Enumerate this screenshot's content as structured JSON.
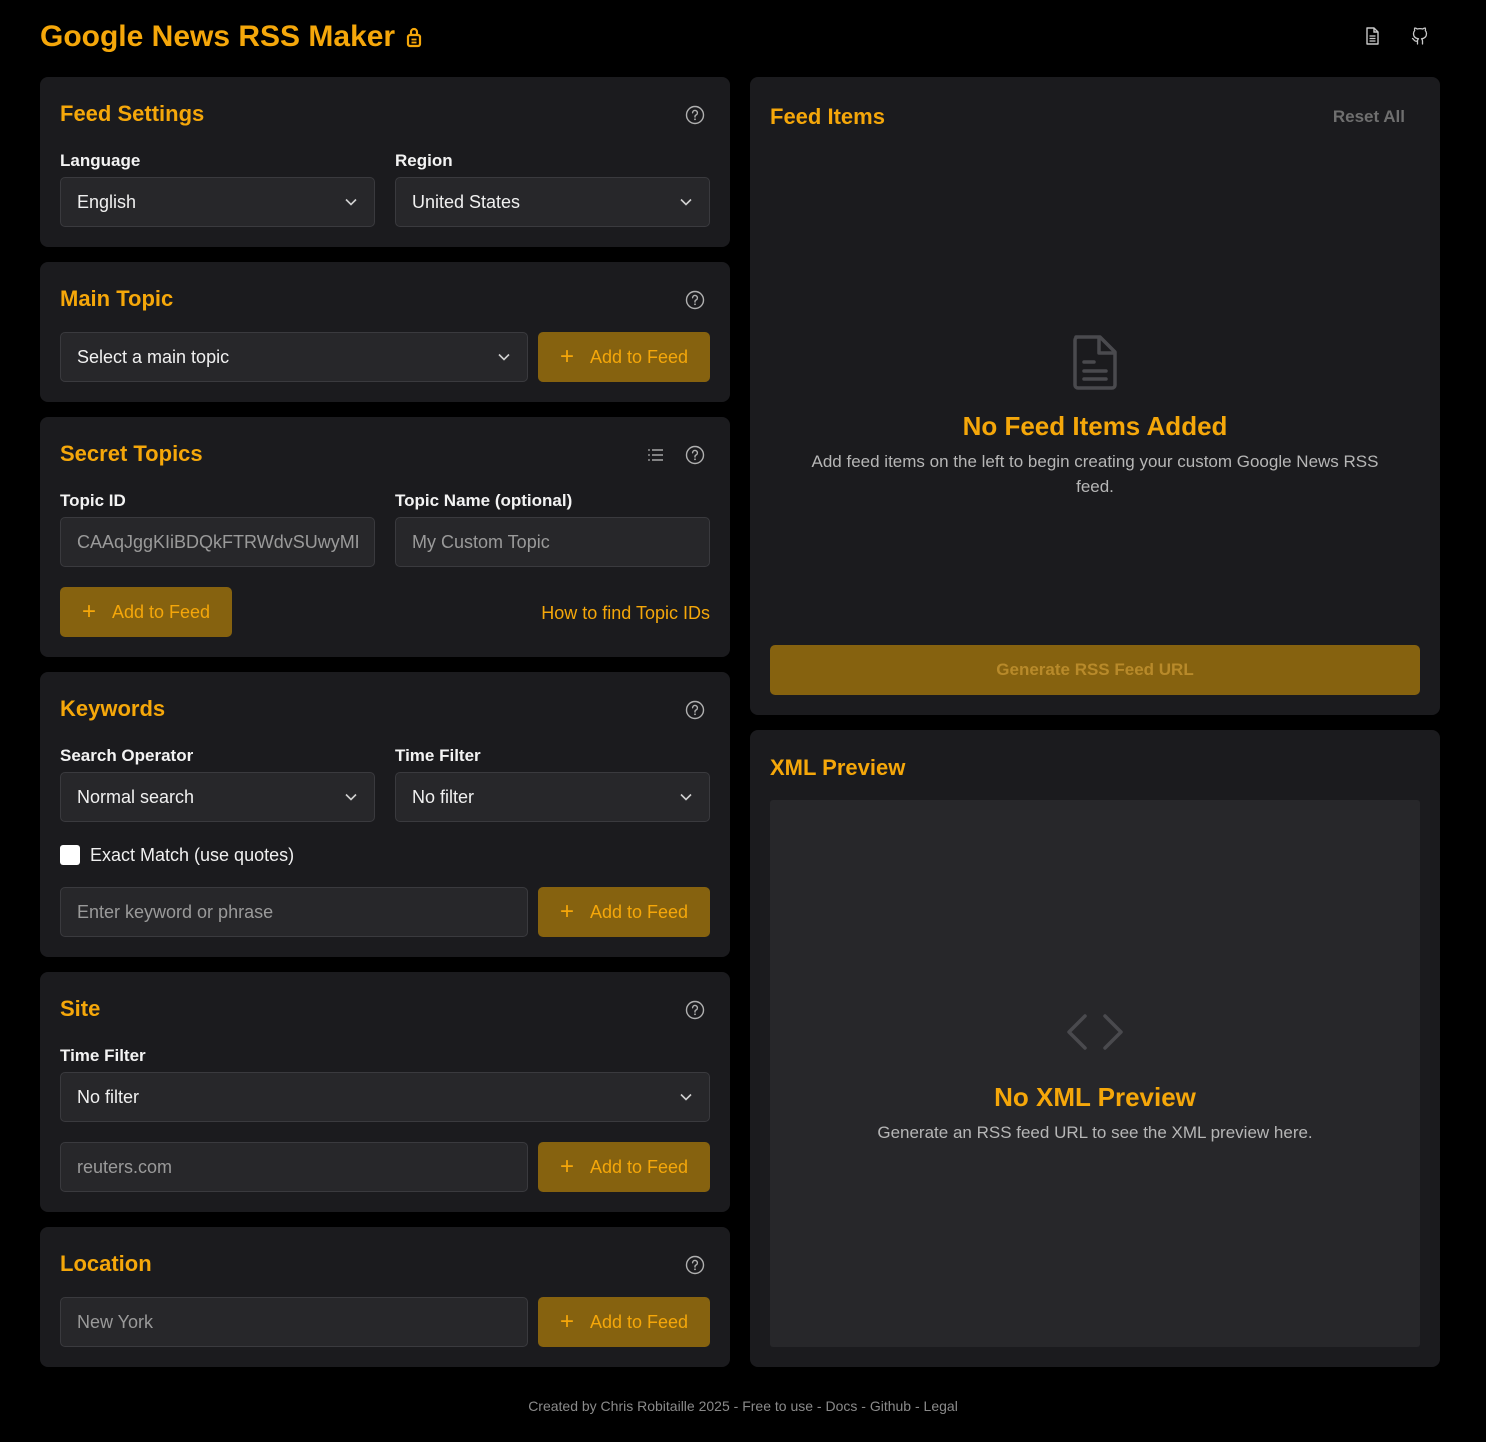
{
  "header": {
    "title": "Google News RSS Maker",
    "icons": [
      "lock-icon",
      "docs-icon",
      "github-icon"
    ]
  },
  "feed_settings": {
    "title": "Feed Settings",
    "language_label": "Language",
    "language_value": "English",
    "region_label": "Region",
    "region_value": "United States"
  },
  "main_topic": {
    "title": "Main Topic",
    "select_value": "Select a main topic",
    "add_label": "Add to Feed"
  },
  "secret_topics": {
    "title": "Secret Topics",
    "topic_id_label": "Topic ID",
    "topic_id_placeholder": "CAAqJggKIiBDQkFTRWdvSUwyMHZN",
    "topic_name_label": "Topic Name (optional)",
    "topic_name_placeholder": "My Custom Topic",
    "add_label": "Add to Feed",
    "help_link": "How to find Topic IDs"
  },
  "keywords": {
    "title": "Keywords",
    "operator_label": "Search Operator",
    "operator_value": "Normal search",
    "time_filter_label": "Time Filter",
    "time_filter_value": "No filter",
    "exact_match_label": "Exact Match (use quotes)",
    "exact_match_checked": false,
    "keyword_placeholder": "Enter keyword or phrase",
    "add_label": "Add to Feed"
  },
  "site": {
    "title": "Site",
    "time_filter_label": "Time Filter",
    "time_filter_value": "No filter",
    "site_placeholder": "reuters.com",
    "add_label": "Add to Feed"
  },
  "location": {
    "title": "Location",
    "location_placeholder": "New York",
    "add_label": "Add to Feed"
  },
  "feed_items": {
    "title": "Feed Items",
    "reset_label": "Reset All",
    "empty_title": "No Feed Items Added",
    "empty_text": "Add feed items on the left to begin creating your custom Google News RSS feed.",
    "generate_label": "Generate RSS Feed URL"
  },
  "xml_preview": {
    "title": "XML Preview",
    "empty_title": "No XML Preview",
    "empty_text": "Generate an RSS feed URL to see the XML preview here."
  },
  "footer": {
    "credit": "Created by Chris Robitaille 2025",
    "free": "Free to use",
    "docs": "Docs",
    "github": "Github",
    "legal": "Legal",
    "separator": " - "
  },
  "colors": {
    "accent": "#f5a70a",
    "button_bg": "#86620f",
    "card_bg": "#1b1b1e",
    "field_bg": "#27272a",
    "page_bg": "#000000"
  }
}
